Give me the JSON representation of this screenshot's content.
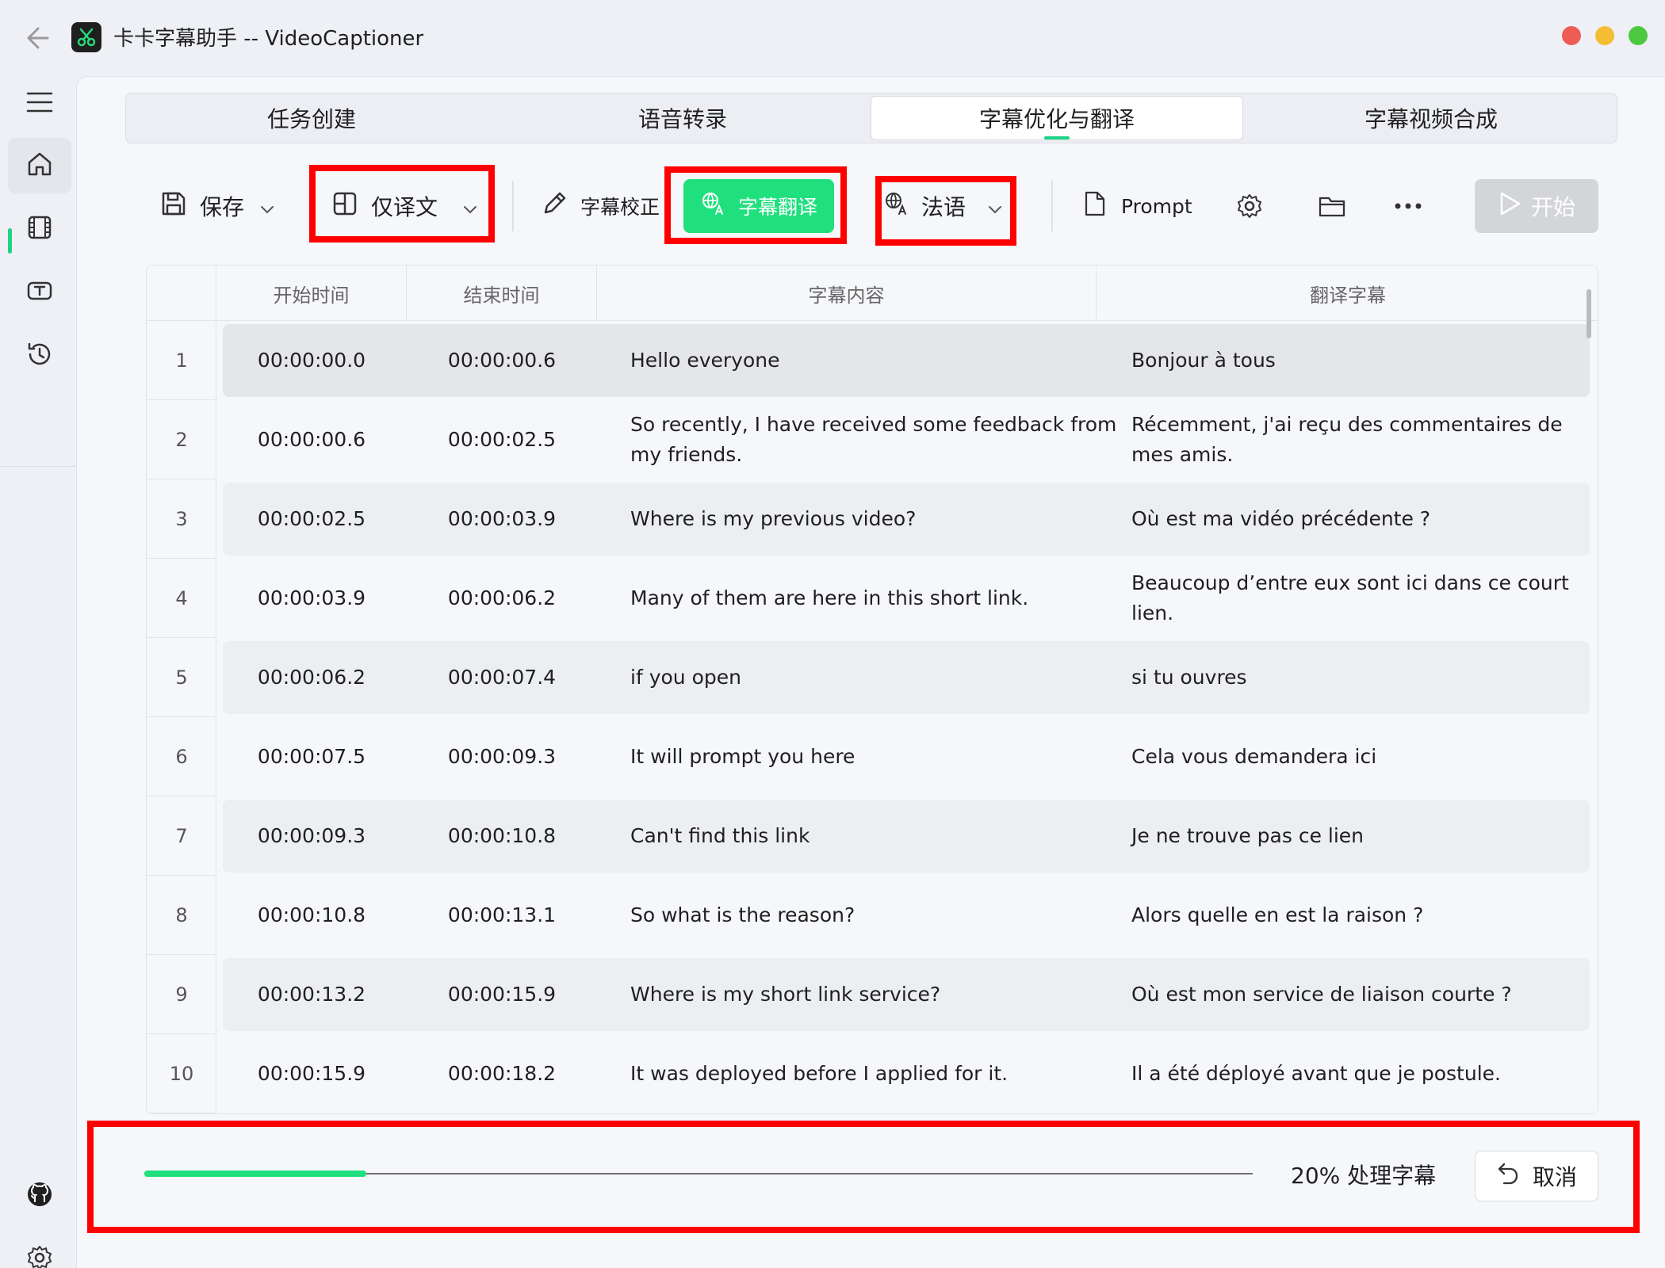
{
  "window": {
    "title": "卡卡字幕助手 -- VideoCaptioner"
  },
  "sidebar": {
    "items": [
      {
        "icon": "menu-icon"
      },
      {
        "icon": "home-icon",
        "active": true
      },
      {
        "icon": "film-icon"
      },
      {
        "icon": "text-box-icon"
      },
      {
        "icon": "history-icon"
      }
    ],
    "bottom": [
      {
        "icon": "github-icon"
      },
      {
        "icon": "gear-icon"
      }
    ]
  },
  "tabs": [
    {
      "label": "任务创建",
      "active": false
    },
    {
      "label": "语音转录",
      "active": false
    },
    {
      "label": "字幕优化与翻译",
      "active": true
    },
    {
      "label": "字幕视频合成",
      "active": false
    }
  ],
  "toolbar": {
    "save_label": "保存",
    "layout_label": "仅译文",
    "proofread_label": "字幕校正",
    "translate_label": "字幕翻译",
    "language_label": "法语",
    "prompt_label": "Prompt",
    "start_label": "开始"
  },
  "table": {
    "columns": [
      "开始时间",
      "结束时间",
      "字幕内容",
      "翻译字幕"
    ],
    "rows": [
      {
        "num": "1",
        "start": "00:00:00.0",
        "end": "00:00:00.6",
        "text": "Hello everyone",
        "translation": "Bonjour à tous"
      },
      {
        "num": "2",
        "start": "00:00:00.6",
        "end": "00:00:02.5",
        "text": "So recently, I have received some feedback from my friends.",
        "translation": "Récemment, j'ai reçu des commentaires de mes amis."
      },
      {
        "num": "3",
        "start": "00:00:02.5",
        "end": "00:00:03.9",
        "text": "Where is my previous video?",
        "translation": "Où est ma vidéo précédente ?"
      },
      {
        "num": "4",
        "start": "00:00:03.9",
        "end": "00:00:06.2",
        "text": "Many of them are here in this short link.",
        "translation": "Beaucoup d’entre eux sont ici dans ce court lien."
      },
      {
        "num": "5",
        "start": "00:00:06.2",
        "end": "00:00:07.4",
        "text": "if you open",
        "translation": "si tu ouvres"
      },
      {
        "num": "6",
        "start": "00:00:07.5",
        "end": "00:00:09.3",
        "text": "It will prompt you here",
        "translation": "Cela vous demandera ici"
      },
      {
        "num": "7",
        "start": "00:00:09.3",
        "end": "00:00:10.8",
        "text": "Can't find this link",
        "translation": "Je ne trouve pas ce lien"
      },
      {
        "num": "8",
        "start": "00:00:10.8",
        "end": "00:00:13.1",
        "text": "So what is the reason?",
        "translation": "Alors quelle en est la raison ?"
      },
      {
        "num": "9",
        "start": "00:00:13.2",
        "end": "00:00:15.9",
        "text": "Where is my short link service?",
        "translation": "Où est mon service de liaison courte ?"
      },
      {
        "num": "10",
        "start": "00:00:15.9",
        "end": "00:00:18.2",
        "text": "It was deployed before I applied for it.",
        "translation": "Il a été déployé avant que je postule."
      }
    ]
  },
  "progress": {
    "fraction": 0.2,
    "text": "20% 处理字幕",
    "cancel_label": "取消"
  },
  "colors": {
    "accent": "#1fe07d",
    "highlight": "#ff0000",
    "start_disabled": "#d3d5d9"
  }
}
